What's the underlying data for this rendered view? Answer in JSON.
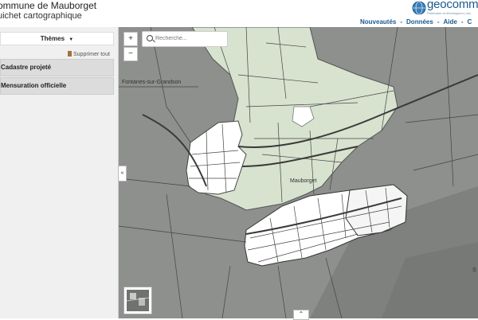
{
  "header": {
    "title": "ommune de Mauborget",
    "subtitle": "uichet cartographique",
    "logo": {
      "text": "geocomm",
      "tagline": "Partenaire et développeur | Asi",
      "icon": "globe-icon"
    },
    "nav": [
      "Nouveautés",
      "Données",
      "Aide",
      "C"
    ],
    "accent": "#1a5a8f"
  },
  "sidebar": {
    "themes_label": "Thèmes",
    "delete_all_label": "Supprimer tout",
    "layers": [
      "Cadastre projeté",
      "Mensuration officielle"
    ]
  },
  "map": {
    "search_placeholder": "Recherche...",
    "zoom_in": "+",
    "zoom_out": "−",
    "places": {
      "fontanes": "Fontanes-sur-Grandson",
      "mauborget": "Mauborget",
      "edge": "S"
    },
    "collapse_glyph": "«",
    "expand_glyph": "⌃"
  }
}
